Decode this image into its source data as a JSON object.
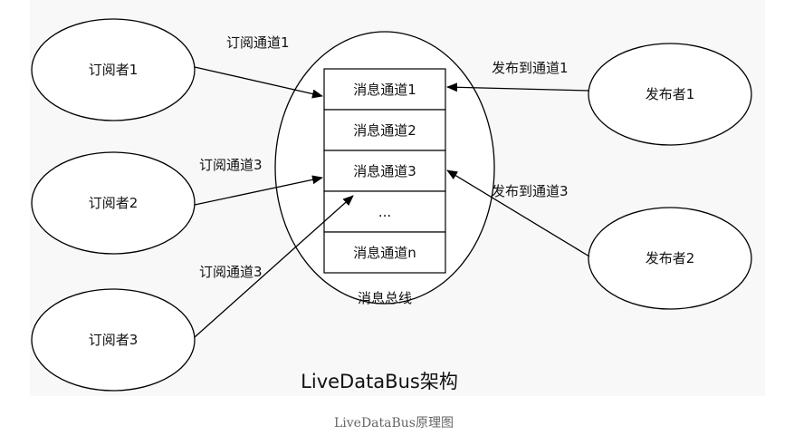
{
  "diagram": {
    "title": "LiveDataBus架构",
    "caption": "LiveDataBus原理图",
    "bus": {
      "label": "消息总线",
      "channels": [
        "消息通道1",
        "消息通道2",
        "消息通道3",
        "...",
        "消息通道n"
      ]
    },
    "subscribers": [
      "订阅者1",
      "订阅者2",
      "订阅者3"
    ],
    "publishers": [
      "发布者1",
      "发布者2"
    ],
    "edges": [
      {
        "label": "订阅通道1",
        "from": "订阅者1",
        "to": "消息通道1"
      },
      {
        "label": "订阅通道3",
        "from": "订阅者2",
        "to": "消息通道3"
      },
      {
        "label": "订阅通道3",
        "from": "订阅者3",
        "to": "消息通道3"
      },
      {
        "label": "发布到通道1",
        "from": "发布者1",
        "to": "消息通道1"
      },
      {
        "label": "发布到通道3",
        "from": "发布者2",
        "to": "消息通道3"
      }
    ]
  }
}
